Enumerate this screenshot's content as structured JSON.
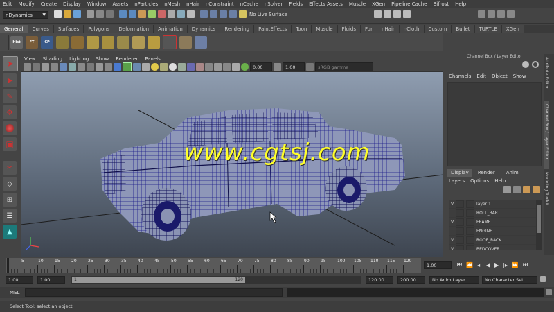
{
  "menubar": [
    "Edit",
    "Modify",
    "Create",
    "Display",
    "Window",
    "Assets",
    "nParticles",
    "nMesh",
    "nHair",
    "nConstraint",
    "nCache",
    "nSolver",
    "Fields",
    "Effects Assets",
    "Muscle",
    "XGen",
    "Pipeline Cache",
    "Bifrost",
    "Help"
  ],
  "statusline": {
    "mode": "nDynamics",
    "live_surface": "No Live Surface"
  },
  "shelf_tabs": [
    "General",
    "Curves",
    "Surfaces",
    "Polygons",
    "Deformation",
    "Animation",
    "Dynamics",
    "Rendering",
    "PaintEffects",
    "Toon",
    "Muscle",
    "Fluids",
    "Fur",
    "nHair",
    "nCloth",
    "Custom",
    "Bullet",
    "TURTLE",
    "XGen"
  ],
  "shelf_labels": [
    "Hist",
    "FT",
    "CP"
  ],
  "viewport_menu": [
    "View",
    "Shading",
    "Lighting",
    "Show",
    "Renderer",
    "Panels"
  ],
  "viewport_toolbar": {
    "exposure": "0.00",
    "gamma": "1.00",
    "colorspace": "sRGB gamma"
  },
  "watermark": "www.cgtsj.com",
  "channelbox": {
    "title": "Channel Box / Layer Editor",
    "menu": [
      "Channels",
      "Edit",
      "Object",
      "Show"
    ]
  },
  "layer_editor": {
    "tabs": [
      "Display",
      "Render",
      "Anim"
    ],
    "menu": [
      "Layers",
      "Options",
      "Help"
    ],
    "layers": [
      {
        "v": "V",
        "name": "layer 1"
      },
      {
        "v": "",
        "name": "ROLL_BAR"
      },
      {
        "v": "V",
        "name": "FRAME"
      },
      {
        "v": "",
        "name": "ENGINE"
      },
      {
        "v": "V",
        "name": "ROOF_RACK"
      },
      {
        "v": "V",
        "name": "BEDCOVER"
      }
    ]
  },
  "side_tabs": [
    "Attribute Editor",
    "Channel Box / Layer Editor",
    "Modeling Toolkit"
  ],
  "timeline": {
    "ticks": [
      "5",
      "10",
      "15",
      "20",
      "25",
      "30",
      "35",
      "40",
      "45",
      "50",
      "55",
      "60",
      "65",
      "70",
      "75",
      "80",
      "85",
      "90",
      "95",
      "100",
      "105",
      "110",
      "115",
      "120"
    ],
    "current": "1.00"
  },
  "range": {
    "start": "1.00",
    "start2": "1.00",
    "slider_start": "1",
    "slider_end": "120",
    "end": "120.00",
    "end2": "200.00",
    "anim_layer": "No Anim Layer",
    "character": "No Character Set"
  },
  "cmd": {
    "label": "MEL"
  },
  "help": "Select Tool: select an object"
}
